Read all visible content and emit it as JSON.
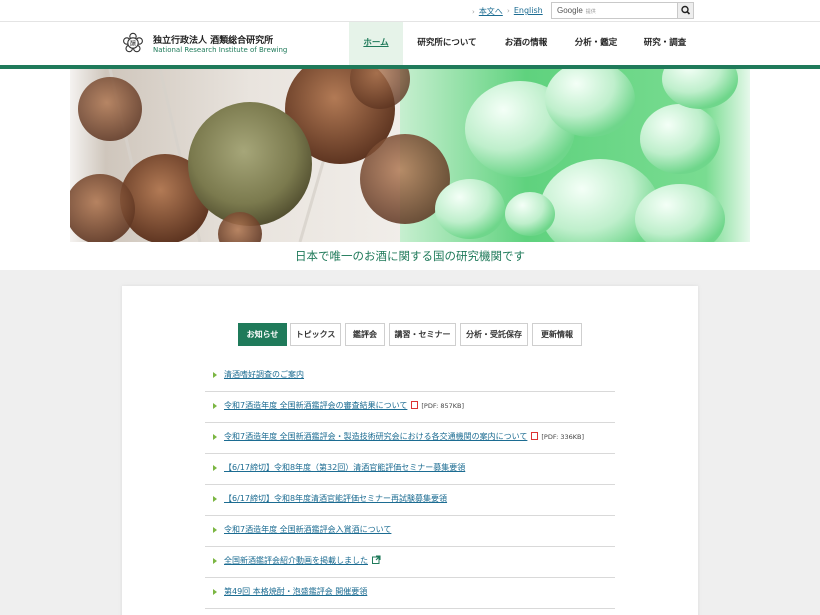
{
  "utility": {
    "honbun": "本文へ",
    "english": "English"
  },
  "search": {
    "placeholder": "",
    "google_label": "Google",
    "google_sub": "提供"
  },
  "org": {
    "name_ja": "独立行政法人 酒類総合研究所",
    "name_en": "National Research Institute of Brewing"
  },
  "nav": [
    "ホーム",
    "研究所について",
    "お酒の情報",
    "分析・鑑定",
    "研究・調査"
  ],
  "tagline": "日本で唯一のお酒に関する国の研究機関です",
  "tabs": [
    "お知らせ",
    "トピックス",
    "鑑評会",
    "講習・セミナー",
    "分析・受託保存",
    "更新情報"
  ],
  "news": [
    {
      "text": "清酒嗜好調査のご案内"
    },
    {
      "text": "令和7酒造年度 全国新酒鑑評会の審査結果について",
      "size": "[PDF: 857KB]"
    },
    {
      "text": "令和7酒造年度 全国新酒鑑評会・製造技術研究会における各交通機関の案内について",
      "size": "[PDF: 336KB]"
    },
    {
      "text": "【6/17締切】令和8年度（第32回）清酒官能評価セミナー募集要領"
    },
    {
      "text": "【6/17締切】令和8年度清酒官能評価セミナー再試験募集要領"
    },
    {
      "text": "令和7酒造年度 全国新酒鑑評会入賞酒について"
    },
    {
      "text": "全国新酒鑑評会紹介動画を掲載しました"
    },
    {
      "text": "第49回 本格焼酎・泡盛鑑評会 開催要領"
    }
  ],
  "colors": {
    "brand_green": "#1f7a5a",
    "link_blue": "#1c6c92",
    "bullet_green": "#7bb642",
    "pdf_red": "#dd3333"
  }
}
